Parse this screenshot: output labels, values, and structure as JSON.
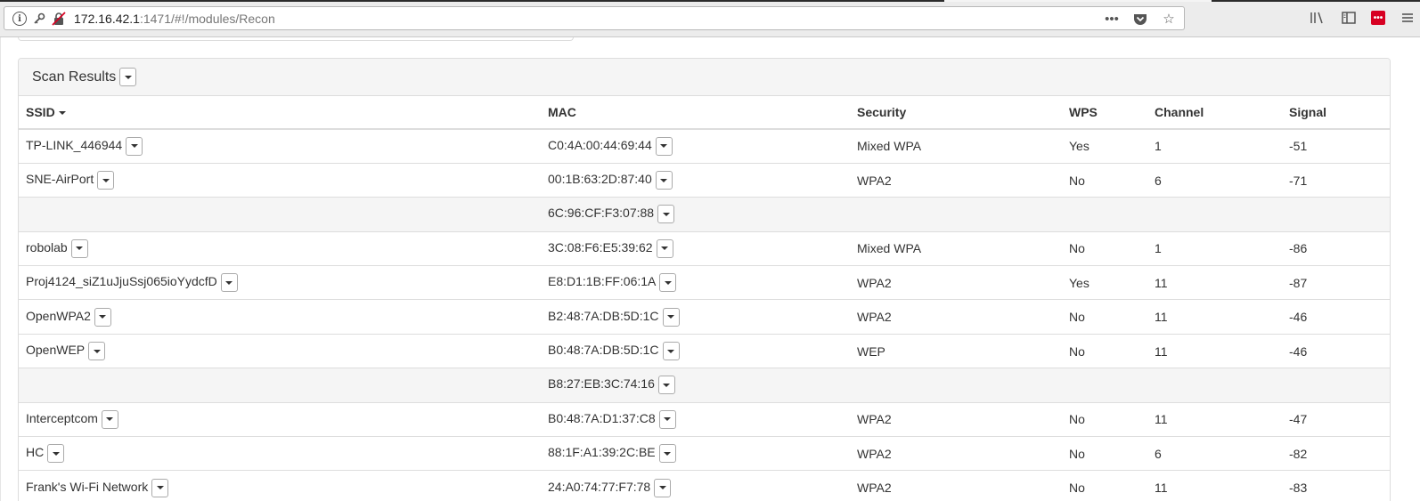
{
  "browser": {
    "url_host": "172.16.42.1",
    "url_rest": ":1471/#!/modules/Recon"
  },
  "panel": {
    "title": "Scan Results"
  },
  "table": {
    "headers": {
      "ssid": "SSID",
      "mac": "MAC",
      "security": "Security",
      "wps": "WPS",
      "channel": "Channel",
      "signal": "Signal"
    },
    "rows": [
      {
        "ssid": "TP-LINK_446944",
        "mac": "C0:4A:00:44:69:44",
        "security": "Mixed WPA",
        "wps": "Yes",
        "channel": "1",
        "signal": "-51"
      },
      {
        "ssid": "SNE-AirPort",
        "mac": "00:1B:63:2D:87:40",
        "security": "WPA2",
        "wps": "No",
        "channel": "6",
        "signal": "-71"
      },
      {
        "ssid": "",
        "mac": "6C:96:CF:F3:07:88",
        "security": "",
        "wps": "",
        "channel": "",
        "signal": ""
      },
      {
        "ssid": "robolab",
        "mac": "3C:08:F6:E5:39:62",
        "security": "Mixed WPA",
        "wps": "No",
        "channel": "1",
        "signal": "-86"
      },
      {
        "ssid": "Proj4124_siZ1uJjuSsj065ioYydcfD",
        "mac": "E8:D1:1B:FF:06:1A",
        "security": "WPA2",
        "wps": "Yes",
        "channel": "11",
        "signal": "-87"
      },
      {
        "ssid": "OpenWPA2",
        "mac": "B2:48:7A:DB:5D:1C",
        "security": "WPA2",
        "wps": "No",
        "channel": "11",
        "signal": "-46"
      },
      {
        "ssid": "OpenWEP",
        "mac": "B0:48:7A:DB:5D:1C",
        "security": "WEP",
        "wps": "No",
        "channel": "11",
        "signal": "-46"
      },
      {
        "ssid": "",
        "mac": "B8:27:EB:3C:74:16",
        "security": "",
        "wps": "",
        "channel": "",
        "signal": ""
      },
      {
        "ssid": "Interceptcom",
        "mac": "B0:48:7A:D1:37:C8",
        "security": "WPA2",
        "wps": "No",
        "channel": "11",
        "signal": "-47"
      },
      {
        "ssid": "HC",
        "mac": "88:1F:A1:39:2C:BE",
        "security": "WPA2",
        "wps": "No",
        "channel": "6",
        "signal": "-82"
      },
      {
        "ssid": "Frank's Wi-Fi Network",
        "mac": "24:A0:74:77:F7:78",
        "security": "WPA2",
        "wps": "No",
        "channel": "11",
        "signal": "-83"
      }
    ]
  }
}
